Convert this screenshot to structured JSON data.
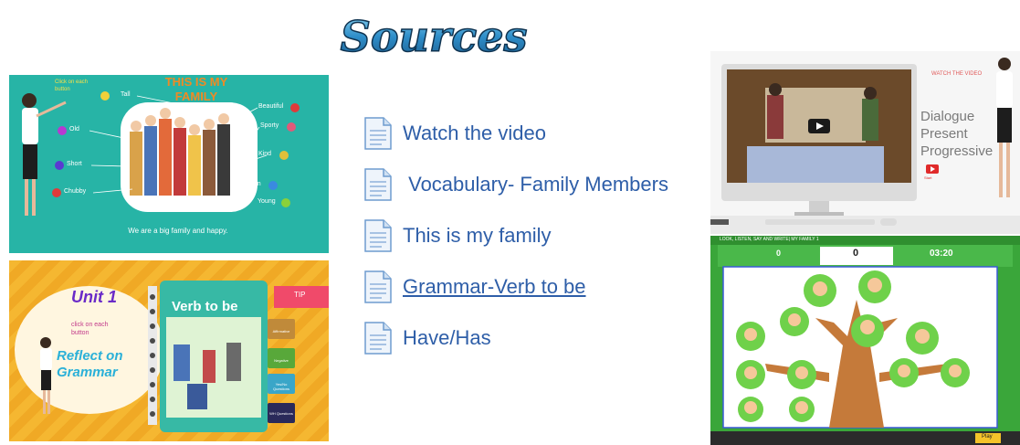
{
  "title": "Sources",
  "links": [
    {
      "label": "Watch the video",
      "underlined": false
    },
    {
      "label": " Vocabulary- Family Members",
      "underlined": false
    },
    {
      "label": "This is my family",
      "underlined": false
    },
    {
      "label": "Grammar-Verb to be",
      "underlined": true
    },
    {
      "label": "Have/Has",
      "underlined": false
    }
  ],
  "family_card": {
    "title": "THIS IS MY FAMILY",
    "hint": "Click on each button",
    "left_words": [
      "Tall",
      "Old",
      "Short",
      "Chubby"
    ],
    "right_words": [
      "Beautiful",
      "Sporty",
      "Kind",
      "Thin",
      "Young"
    ],
    "caption": "We are a big family and happy."
  },
  "grammar_card": {
    "unit": "Unit 1",
    "hint": "click on each button",
    "reflect": "Reflect on Grammar",
    "book_title": "Verb to be",
    "tip": "TIP",
    "buttons": [
      "Affirmative",
      "Negative",
      "Yes/No Questions",
      "WH Questions"
    ]
  },
  "video_card": {
    "label": "WATCH THE VIDEO",
    "side_text": [
      "Dialogue",
      "Present",
      "Progressive"
    ],
    "yt_label": "Start"
  },
  "game_card": {
    "header": "LOOK, LISTEN, SAY AND WRITE| MY FAMILY 1",
    "score_left": "0",
    "score_center": "0",
    "timer": "03:20",
    "play": "Play"
  },
  "colors": {
    "link": "#2e5ea8",
    "title_fill": "#2f8ec9",
    "teal": "#27b4a6",
    "orange": "#f5b731",
    "game_green": "#3aa63a"
  }
}
